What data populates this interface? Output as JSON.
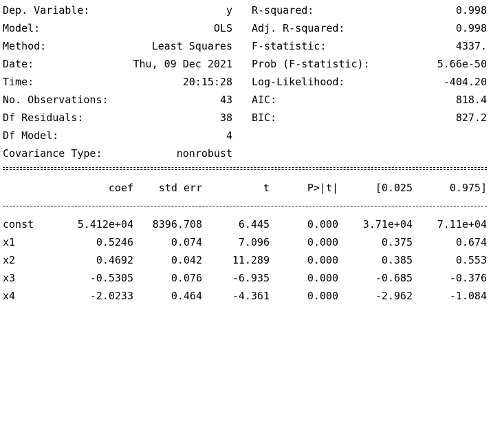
{
  "summary": {
    "left": [
      {
        "label": "Dep. Variable:",
        "value": "y"
      },
      {
        "label": "Model:",
        "value": "OLS"
      },
      {
        "label": "Method:",
        "value": "Least Squares"
      },
      {
        "label": "Date:",
        "value": "Thu, 09 Dec 2021"
      },
      {
        "label": "Time:",
        "value": "20:15:28"
      },
      {
        "label": "No. Observations:",
        "value": "43"
      },
      {
        "label": "Df Residuals:",
        "value": "38"
      },
      {
        "label": "Df Model:",
        "value": "4"
      },
      {
        "label": "Covariance Type:",
        "value": "nonrobust"
      }
    ],
    "right": [
      {
        "label": "R-squared:",
        "value": "0.998"
      },
      {
        "label": "Adj. R-squared:",
        "value": "0.998"
      },
      {
        "label": "F-statistic:",
        "value": "4337."
      },
      {
        "label": "Prob (F-statistic):",
        "value": "5.66e-50"
      },
      {
        "label": "Log-Likelihood:",
        "value": "-404.20"
      },
      {
        "label": "AIC:",
        "value": "818.4"
      },
      {
        "label": "BIC:",
        "value": "827.2"
      }
    ]
  },
  "coef_table": {
    "headers": [
      "coef",
      "std err",
      "t",
      "P>|t|",
      "[0.025",
      "0.975]"
    ],
    "rows": [
      {
        "name": "const",
        "coef": "5.412e+04",
        "std_err": "8396.708",
        "t": "6.445",
        "p": "0.000",
        "lo": "3.71e+04",
        "hi": "7.11e+04"
      },
      {
        "name": "x1",
        "coef": "0.5246",
        "std_err": "0.074",
        "t": "7.096",
        "p": "0.000",
        "lo": "0.375",
        "hi": "0.674"
      },
      {
        "name": "x2",
        "coef": "0.4692",
        "std_err": "0.042",
        "t": "11.289",
        "p": "0.000",
        "lo": "0.385",
        "hi": "0.553"
      },
      {
        "name": "x3",
        "coef": "-0.5305",
        "std_err": "0.076",
        "t": "-6.935",
        "p": "0.000",
        "lo": "-0.685",
        "hi": "-0.376"
      },
      {
        "name": "x4",
        "coef": "-2.0233",
        "std_err": "0.464",
        "t": "-4.361",
        "p": "0.000",
        "lo": "-2.962",
        "hi": "-1.084"
      }
    ]
  }
}
